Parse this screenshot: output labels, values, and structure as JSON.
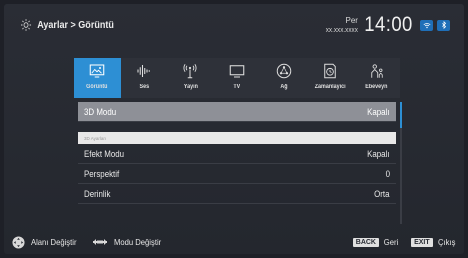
{
  "header": {
    "breadcrumb": "Ayarlar > Görüntü",
    "day": "Per",
    "date": "xx.xxx.xxxx",
    "time": "14:00",
    "badge_icon": "wifi-icon",
    "badge2_icon": "bluetooth-icon"
  },
  "categories": [
    {
      "label": "Görüntü",
      "icon": "picture-icon",
      "active": true
    },
    {
      "label": "Ses",
      "icon": "sound-icon",
      "active": false
    },
    {
      "label": "Yayın",
      "icon": "broadcast-icon",
      "active": false
    },
    {
      "label": "TV",
      "icon": "tv-icon",
      "active": false
    },
    {
      "label": "Ağ",
      "icon": "network-icon",
      "active": false
    },
    {
      "label": "Zamanlayıcı",
      "icon": "timer-icon",
      "active": false
    },
    {
      "label": "Ebeveyn",
      "icon": "parental-icon",
      "active": false
    }
  ],
  "menu": {
    "rows": [
      {
        "label": "3D Modu",
        "value": "Kapalı"
      },
      {
        "label": "Efekt Modu",
        "value": "Kapalı"
      },
      {
        "label": "Perspektif",
        "value": "0"
      },
      {
        "label": "Derinlik",
        "value": "Orta"
      }
    ],
    "section_label": "3D Ayarları"
  },
  "footer": {
    "nav_label": "Alanı Değiştir",
    "mode_label": "Modu Değiştir",
    "back_key": "BACK",
    "back_label": "Geri",
    "exit_key": "EXIT",
    "exit_label": "Çıkış"
  },
  "colors": {
    "accent": "#2d8fd4",
    "highlight_row": "#8e9097",
    "background": "#24272e"
  }
}
